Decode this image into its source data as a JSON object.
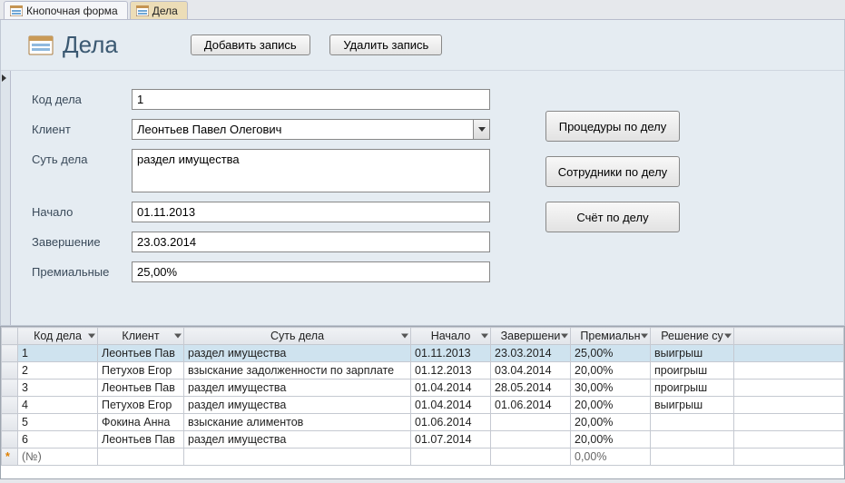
{
  "tabs": [
    {
      "label": "Кнопочная форма"
    },
    {
      "label": "Дела"
    }
  ],
  "form": {
    "title": "Дела",
    "btn_add": "Добавить запись",
    "btn_del": "Удалить запись",
    "labels": {
      "kod": "Код дела",
      "client": "Клиент",
      "sut": "Суть дела",
      "start": "Начало",
      "end": "Завершение",
      "prem": "Премиальные"
    },
    "values": {
      "kod": "1",
      "client": "Леонтьев Павел Олегович",
      "sut": "раздел имущества",
      "start": "01.11.2013",
      "end": "23.03.2014",
      "prem": "25,00%"
    },
    "side": {
      "proc": "Процедуры по делу",
      "emp": "Сотрудники по делу",
      "bill": "Счёт по делу"
    }
  },
  "grid": {
    "headers": {
      "kod": "Код дела",
      "client": "Клиент",
      "sut": "Суть дела",
      "start": "Начало",
      "end": "Завершени",
      "prem": "Премиальн",
      "resh": "Решение су"
    },
    "rows": [
      {
        "kod": "1",
        "client": "Леонтьев Пав",
        "sut": "раздел имущества",
        "start": "01.11.2013",
        "end": "23.03.2014",
        "prem": "25,00%",
        "resh": "выигрыш"
      },
      {
        "kod": "2",
        "client": "Петухов Егор",
        "sut": "взыскание задолженности по зарплате",
        "start": "01.12.2013",
        "end": "03.04.2014",
        "prem": "20,00%",
        "resh": "проигрыш"
      },
      {
        "kod": "3",
        "client": "Леонтьев Пав",
        "sut": "раздел имущества",
        "start": "01.04.2014",
        "end": "28.05.2014",
        "prem": "30,00%",
        "resh": "проигрыш"
      },
      {
        "kod": "4",
        "client": "Петухов Егор",
        "sut": "раздел имущества",
        "start": "01.04.2014",
        "end": "01.06.2014",
        "prem": "20,00%",
        "resh": "выигрыш"
      },
      {
        "kod": "5",
        "client": "Фокина Анна",
        "sut": "взыскание алиментов",
        "start": "01.06.2014",
        "end": "",
        "prem": "20,00%",
        "resh": ""
      },
      {
        "kod": "6",
        "client": "Леонтьев Пав",
        "sut": "раздел имущества",
        "start": "01.07.2014",
        "end": "",
        "prem": "20,00%",
        "resh": ""
      }
    ],
    "newrow": {
      "kod": "(№)",
      "prem": "0,00%"
    }
  }
}
